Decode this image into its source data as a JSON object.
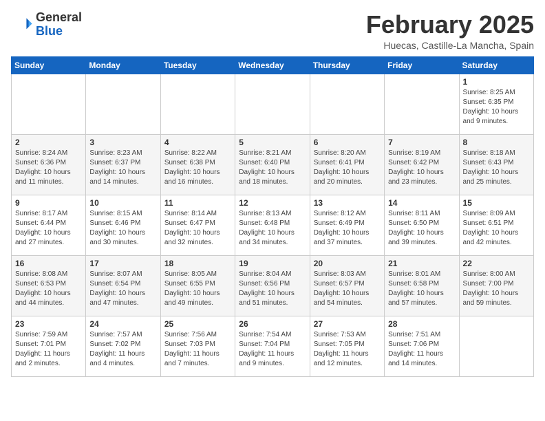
{
  "logo": {
    "general": "General",
    "blue": "Blue"
  },
  "header": {
    "month": "February 2025",
    "location": "Huecas, Castille-La Mancha, Spain"
  },
  "weekdays": [
    "Sunday",
    "Monday",
    "Tuesday",
    "Wednesday",
    "Thursday",
    "Friday",
    "Saturday"
  ],
  "weeks": [
    [
      {
        "day": "",
        "info": ""
      },
      {
        "day": "",
        "info": ""
      },
      {
        "day": "",
        "info": ""
      },
      {
        "day": "",
        "info": ""
      },
      {
        "day": "",
        "info": ""
      },
      {
        "day": "",
        "info": ""
      },
      {
        "day": "1",
        "info": "Sunrise: 8:25 AM\nSunset: 6:35 PM\nDaylight: 10 hours\nand 9 minutes."
      }
    ],
    [
      {
        "day": "2",
        "info": "Sunrise: 8:24 AM\nSunset: 6:36 PM\nDaylight: 10 hours\nand 11 minutes."
      },
      {
        "day": "3",
        "info": "Sunrise: 8:23 AM\nSunset: 6:37 PM\nDaylight: 10 hours\nand 14 minutes."
      },
      {
        "day": "4",
        "info": "Sunrise: 8:22 AM\nSunset: 6:38 PM\nDaylight: 10 hours\nand 16 minutes."
      },
      {
        "day": "5",
        "info": "Sunrise: 8:21 AM\nSunset: 6:40 PM\nDaylight: 10 hours\nand 18 minutes."
      },
      {
        "day": "6",
        "info": "Sunrise: 8:20 AM\nSunset: 6:41 PM\nDaylight: 10 hours\nand 20 minutes."
      },
      {
        "day": "7",
        "info": "Sunrise: 8:19 AM\nSunset: 6:42 PM\nDaylight: 10 hours\nand 23 minutes."
      },
      {
        "day": "8",
        "info": "Sunrise: 8:18 AM\nSunset: 6:43 PM\nDaylight: 10 hours\nand 25 minutes."
      }
    ],
    [
      {
        "day": "9",
        "info": "Sunrise: 8:17 AM\nSunset: 6:44 PM\nDaylight: 10 hours\nand 27 minutes."
      },
      {
        "day": "10",
        "info": "Sunrise: 8:15 AM\nSunset: 6:46 PM\nDaylight: 10 hours\nand 30 minutes."
      },
      {
        "day": "11",
        "info": "Sunrise: 8:14 AM\nSunset: 6:47 PM\nDaylight: 10 hours\nand 32 minutes."
      },
      {
        "day": "12",
        "info": "Sunrise: 8:13 AM\nSunset: 6:48 PM\nDaylight: 10 hours\nand 34 minutes."
      },
      {
        "day": "13",
        "info": "Sunrise: 8:12 AM\nSunset: 6:49 PM\nDaylight: 10 hours\nand 37 minutes."
      },
      {
        "day": "14",
        "info": "Sunrise: 8:11 AM\nSunset: 6:50 PM\nDaylight: 10 hours\nand 39 minutes."
      },
      {
        "day": "15",
        "info": "Sunrise: 8:09 AM\nSunset: 6:51 PM\nDaylight: 10 hours\nand 42 minutes."
      }
    ],
    [
      {
        "day": "16",
        "info": "Sunrise: 8:08 AM\nSunset: 6:53 PM\nDaylight: 10 hours\nand 44 minutes."
      },
      {
        "day": "17",
        "info": "Sunrise: 8:07 AM\nSunset: 6:54 PM\nDaylight: 10 hours\nand 47 minutes."
      },
      {
        "day": "18",
        "info": "Sunrise: 8:05 AM\nSunset: 6:55 PM\nDaylight: 10 hours\nand 49 minutes."
      },
      {
        "day": "19",
        "info": "Sunrise: 8:04 AM\nSunset: 6:56 PM\nDaylight: 10 hours\nand 51 minutes."
      },
      {
        "day": "20",
        "info": "Sunrise: 8:03 AM\nSunset: 6:57 PM\nDaylight: 10 hours\nand 54 minutes."
      },
      {
        "day": "21",
        "info": "Sunrise: 8:01 AM\nSunset: 6:58 PM\nDaylight: 10 hours\nand 57 minutes."
      },
      {
        "day": "22",
        "info": "Sunrise: 8:00 AM\nSunset: 7:00 PM\nDaylight: 10 hours\nand 59 minutes."
      }
    ],
    [
      {
        "day": "23",
        "info": "Sunrise: 7:59 AM\nSunset: 7:01 PM\nDaylight: 11 hours\nand 2 minutes."
      },
      {
        "day": "24",
        "info": "Sunrise: 7:57 AM\nSunset: 7:02 PM\nDaylight: 11 hours\nand 4 minutes."
      },
      {
        "day": "25",
        "info": "Sunrise: 7:56 AM\nSunset: 7:03 PM\nDaylight: 11 hours\nand 7 minutes."
      },
      {
        "day": "26",
        "info": "Sunrise: 7:54 AM\nSunset: 7:04 PM\nDaylight: 11 hours\nand 9 minutes."
      },
      {
        "day": "27",
        "info": "Sunrise: 7:53 AM\nSunset: 7:05 PM\nDaylight: 11 hours\nand 12 minutes."
      },
      {
        "day": "28",
        "info": "Sunrise: 7:51 AM\nSunset: 7:06 PM\nDaylight: 11 hours\nand 14 minutes."
      },
      {
        "day": "",
        "info": ""
      }
    ]
  ]
}
